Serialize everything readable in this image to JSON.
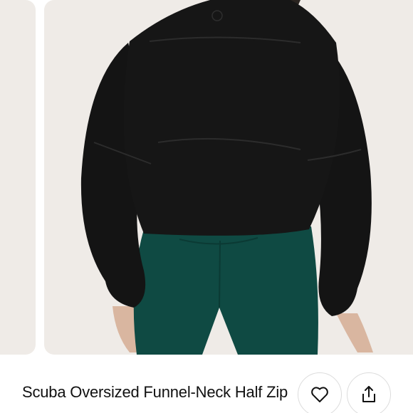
{
  "product": {
    "title": "Scuba Oversized Funnel-Neck Half Zip"
  },
  "gallery": {
    "background": "#efebe7",
    "garment_color": "#141414",
    "leggings_color": "#0f4a43"
  },
  "actions": {
    "like_icon": "heart-icon",
    "share_icon": "share-icon"
  }
}
